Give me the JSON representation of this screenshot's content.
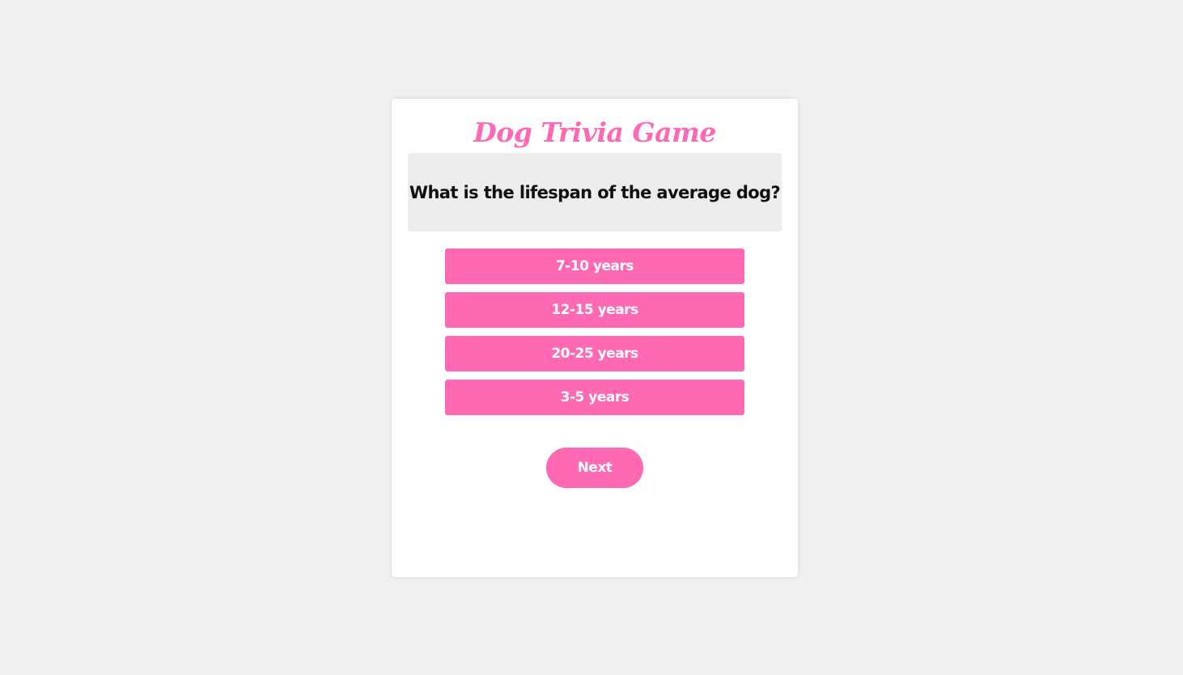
{
  "game": {
    "title": "Dog Trivia Game",
    "question": "What is the lifespan of the average dog?",
    "answers": [
      {
        "label": "7-10 years"
      },
      {
        "label": "12-15 years"
      },
      {
        "label": "20-25 years"
      },
      {
        "label": "3-5 years"
      }
    ],
    "next_label": "Next"
  },
  "colors": {
    "accent": "#ff69b4",
    "background": "#f0f0f0",
    "card": "#ffffff",
    "question_box": "#ececec"
  }
}
